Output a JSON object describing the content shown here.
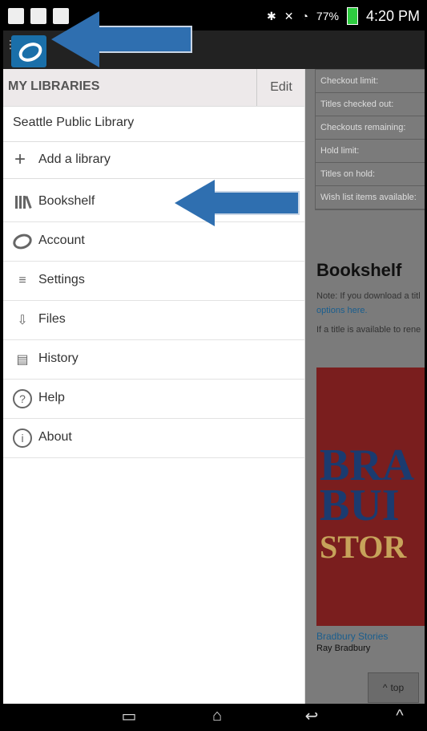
{
  "statusbar": {
    "battery": "77%",
    "time": "4:20 PM"
  },
  "drawer": {
    "header_title": "MY LIBRARIES",
    "edit_label": "Edit",
    "library_name": "Seattle Public Library",
    "add_library_label": "Add a library",
    "menu_items": [
      {
        "label": "Bookshelf",
        "icon": "bookshelf-icon"
      },
      {
        "label": "Account",
        "icon": "account-icon"
      },
      {
        "label": "Settings",
        "icon": "settings-icon"
      },
      {
        "label": "Files",
        "icon": "files-icon"
      },
      {
        "label": "History",
        "icon": "history-icon"
      },
      {
        "label": "Help",
        "icon": "help-icon"
      },
      {
        "label": "About",
        "icon": "about-icon"
      }
    ]
  },
  "content": {
    "table_rows": [
      "Checkout limit:",
      "Titles checked out:",
      "Checkouts remaining:",
      "Hold limit:",
      "Titles on hold:",
      "Wish list items available:"
    ],
    "section_title": "Bookshelf",
    "note_text": "Note: If you download a titl",
    "note_link": "options here.",
    "renew_text": "If a title is available to rene",
    "book": {
      "cover_line1": "BRA",
      "cover_line2": "BUI",
      "cover_line3": "STOR",
      "title": "Bradbury Stories",
      "author": "Ray Bradbury"
    },
    "top_button_label": "top"
  },
  "colors": {
    "app_blue": "#1a6fa9",
    "arrow_blue": "#2f6fb0",
    "battery_green": "#2ecc40"
  }
}
